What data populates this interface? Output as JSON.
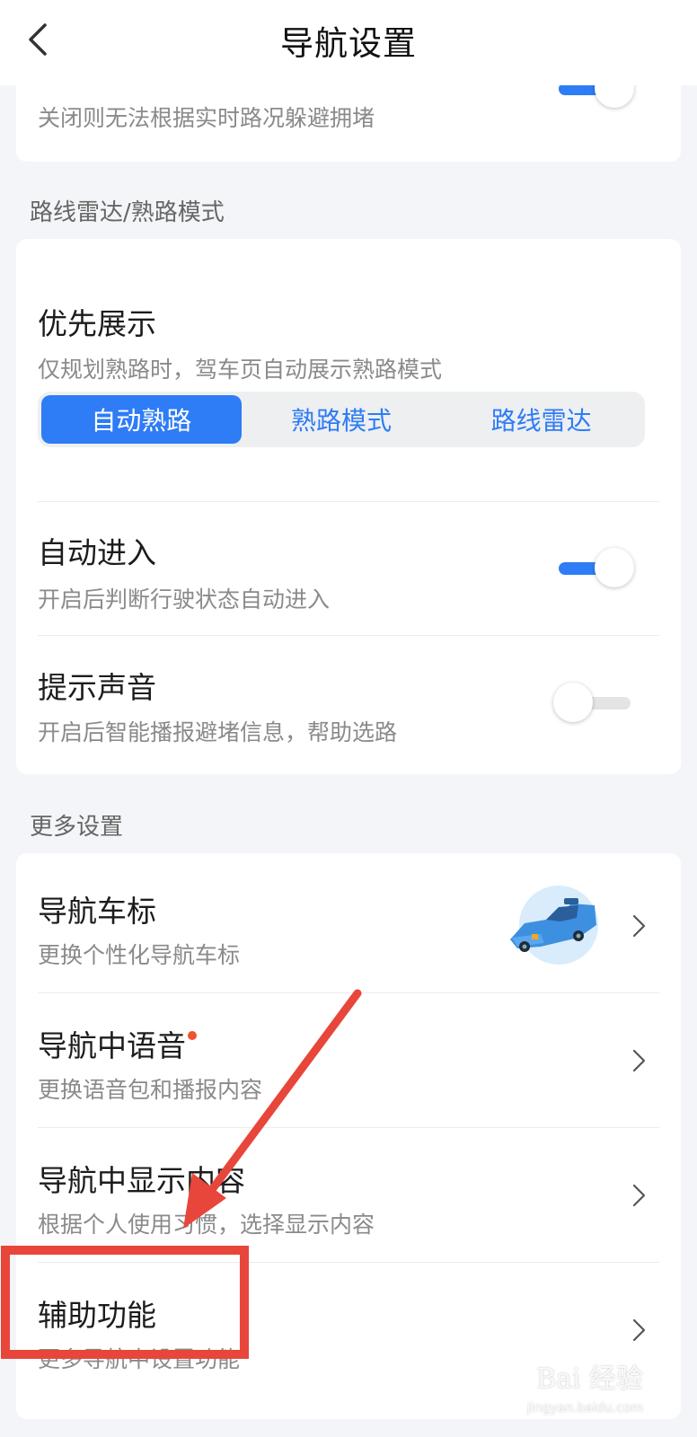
{
  "header": {
    "title": "导航设置"
  },
  "top_card": {
    "sub": "关闭则无法根据实时路况躲避拥堵",
    "toggle_on": true
  },
  "section_route": {
    "label": "路线雷达/熟路模式",
    "priority": {
      "title": "优先展示",
      "sub": "仅规划熟路时，驾车页自动展示熟路模式",
      "options": [
        "自动熟路",
        "熟路模式",
        "路线雷达"
      ],
      "selected": "自动熟路"
    },
    "auto_enter": {
      "title": "自动进入",
      "sub": "开启后判断行驶状态自动进入",
      "toggle_on": true
    },
    "sound": {
      "title": "提示声音",
      "sub": "开启后智能播报避堵信息，帮助选路",
      "toggle_on": false
    }
  },
  "section_more": {
    "label": "更多设置",
    "items": [
      {
        "title": "导航车标",
        "sub": "更换个性化导航车标"
      },
      {
        "title": "导航中语音",
        "sub": "更换语音包和播报内容"
      },
      {
        "title": "导航中显示内容",
        "sub": "根据个人使用习惯，选择显示内容"
      },
      {
        "title": "辅助功能",
        "sub": "更多导航中设置功能"
      }
    ]
  },
  "watermark": {
    "text": "Bai 经验",
    "sub": "jingyan.baidu.com"
  },
  "colors": {
    "accent": "#2e7cf6",
    "annotation": "#e8463a",
    "red_dot": "#f0522d"
  },
  "icons": {
    "back": "chevron-left-icon",
    "row_arrow": "chevron-right-icon",
    "car": "taxi-car-icon"
  }
}
